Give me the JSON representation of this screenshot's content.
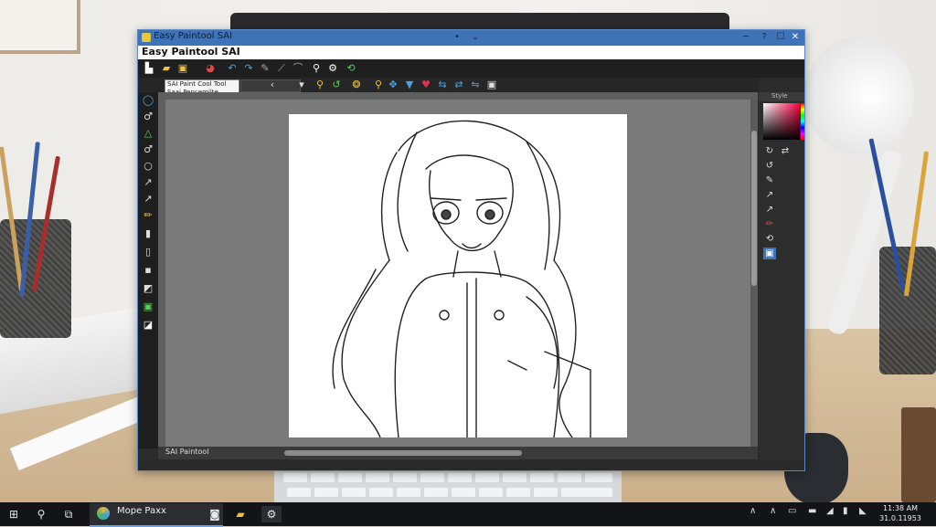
{
  "window": {
    "title": "Easy Paintool SAI",
    "menu_title": "Easy Paintool SAI",
    "controls": {
      "minimize": "─",
      "maximize": "☐",
      "close": "✕",
      "help": "?"
    }
  },
  "tooltip": {
    "line1": "SAI Paint Cool Tool",
    "line2": "Saai Pencemilte"
  },
  "status": {
    "text": "SAI Paintool"
  },
  "right_panel": {
    "header": "Style"
  },
  "taskbar": {
    "app_label": "Mope Paxx",
    "clock_time": "11:38 AM",
    "clock_date": "31.0.11953"
  },
  "colors": {
    "titlebar": "#3f73b8",
    "accent": "#3f73b8",
    "heart": "#e0344a"
  },
  "icons": [
    "start-icon",
    "search-icon",
    "task-view-icon",
    "browser-icon",
    "folder-icon",
    "settings-icon",
    "pen-icon",
    "brush-icon",
    "eraser-icon",
    "zoom-icon",
    "heart-icon",
    "color-picker-icon"
  ]
}
